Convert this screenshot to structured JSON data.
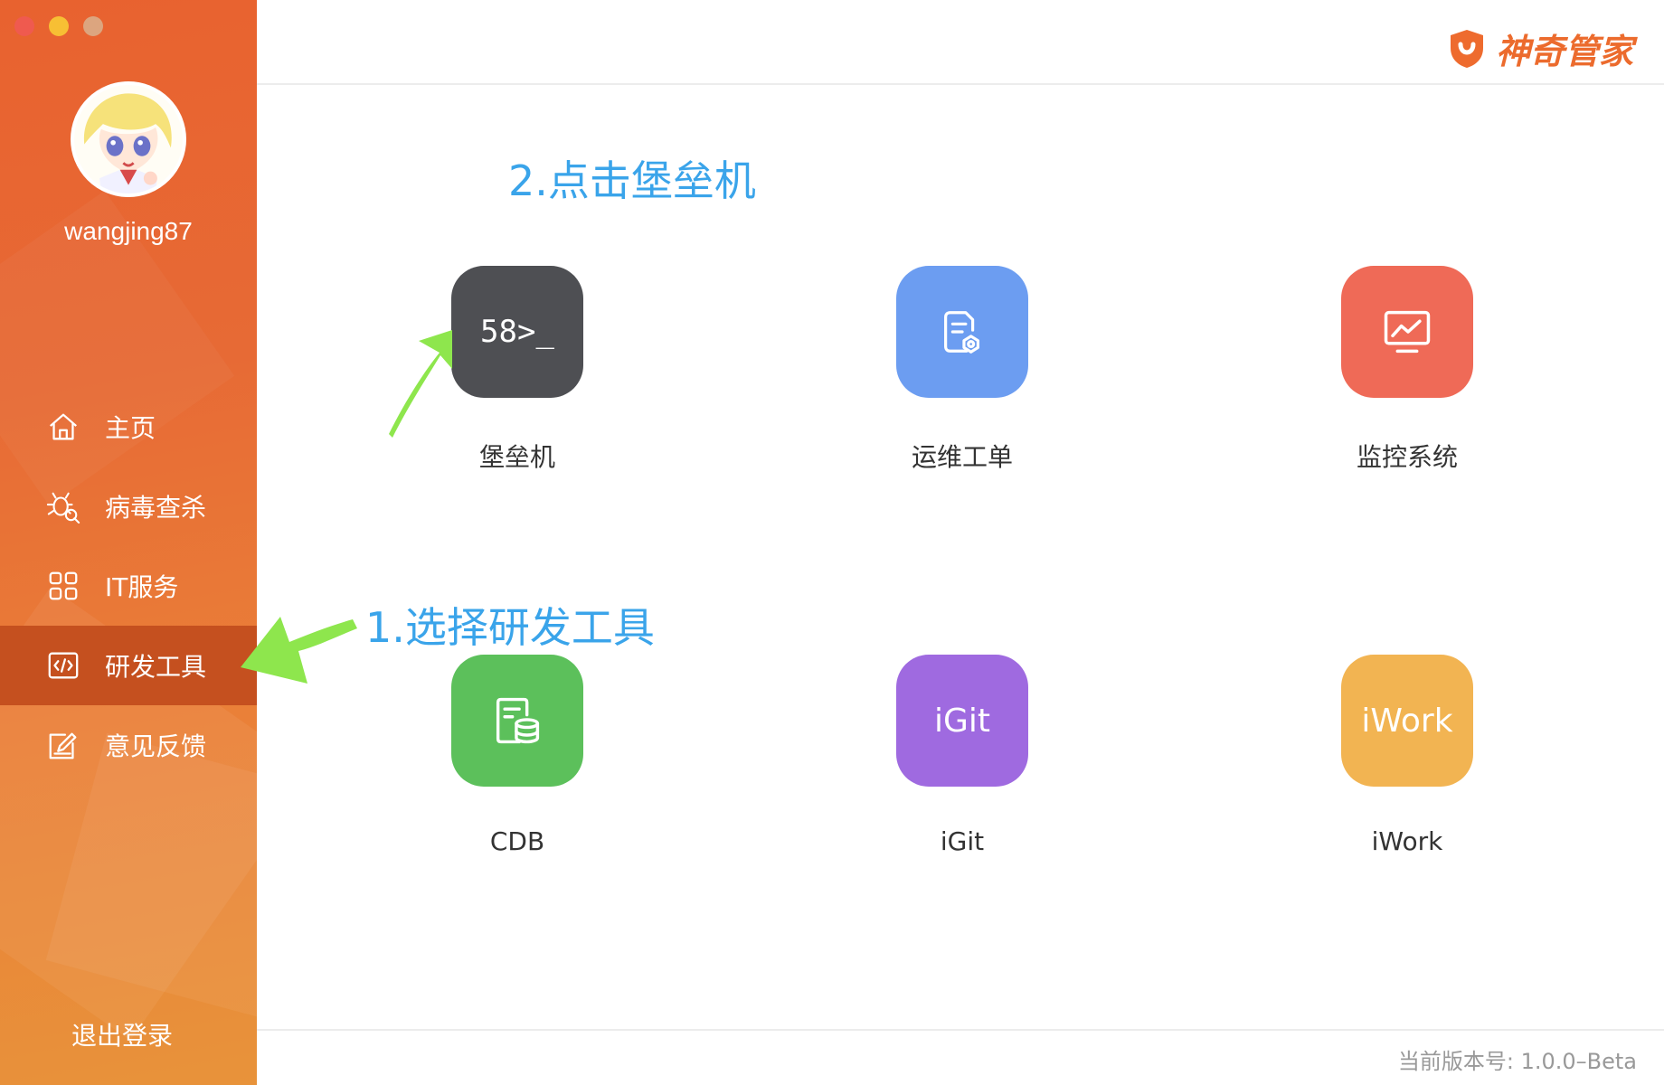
{
  "window": {
    "controls": [
      "close",
      "minimize",
      "zoom"
    ]
  },
  "sidebar": {
    "username": "wangjing87",
    "items": [
      {
        "label": "主页",
        "icon": "home-icon"
      },
      {
        "label": "病毒查杀",
        "icon": "virus-scan-icon"
      },
      {
        "label": "IT服务",
        "icon": "grid-icon"
      },
      {
        "label": "研发工具",
        "icon": "code-icon",
        "active": true
      },
      {
        "label": "意见反馈",
        "icon": "feedback-edit-icon"
      }
    ],
    "logout_label": "退出登录",
    "gradient_color": "#e8622f",
    "active_color": "#c5501f"
  },
  "header": {
    "brand_name": "神奇管家",
    "brand_color": "#ec6b2d"
  },
  "tools": [
    {
      "label": "堡垒机",
      "icon_text": "58>_",
      "icon": "terminal-icon",
      "color": "#4e4f53"
    },
    {
      "label": "运维工单",
      "icon": "work-order-icon",
      "color": "#6c9df1"
    },
    {
      "label": "监控系统",
      "icon": "monitor-chart-icon",
      "color": "#ef6a57"
    },
    {
      "label": "CDB",
      "icon": "database-icon",
      "color": "#5cc05b"
    },
    {
      "label": "iGit",
      "icon_text": "iGit",
      "icon": "igit-icon",
      "color": "#9f6ae0"
    },
    {
      "label": "iWork",
      "icon_text": "iWork",
      "icon": "iwork-icon",
      "color": "#f2b452"
    }
  ],
  "annotations": {
    "step1": "1.选择研发工具",
    "step2": "2.点击堡垒机",
    "arrow_color": "#8ee64d",
    "text_color": "#3aa4ea"
  },
  "footer": {
    "version": "当前版本号: 1.0.0–Beta"
  }
}
